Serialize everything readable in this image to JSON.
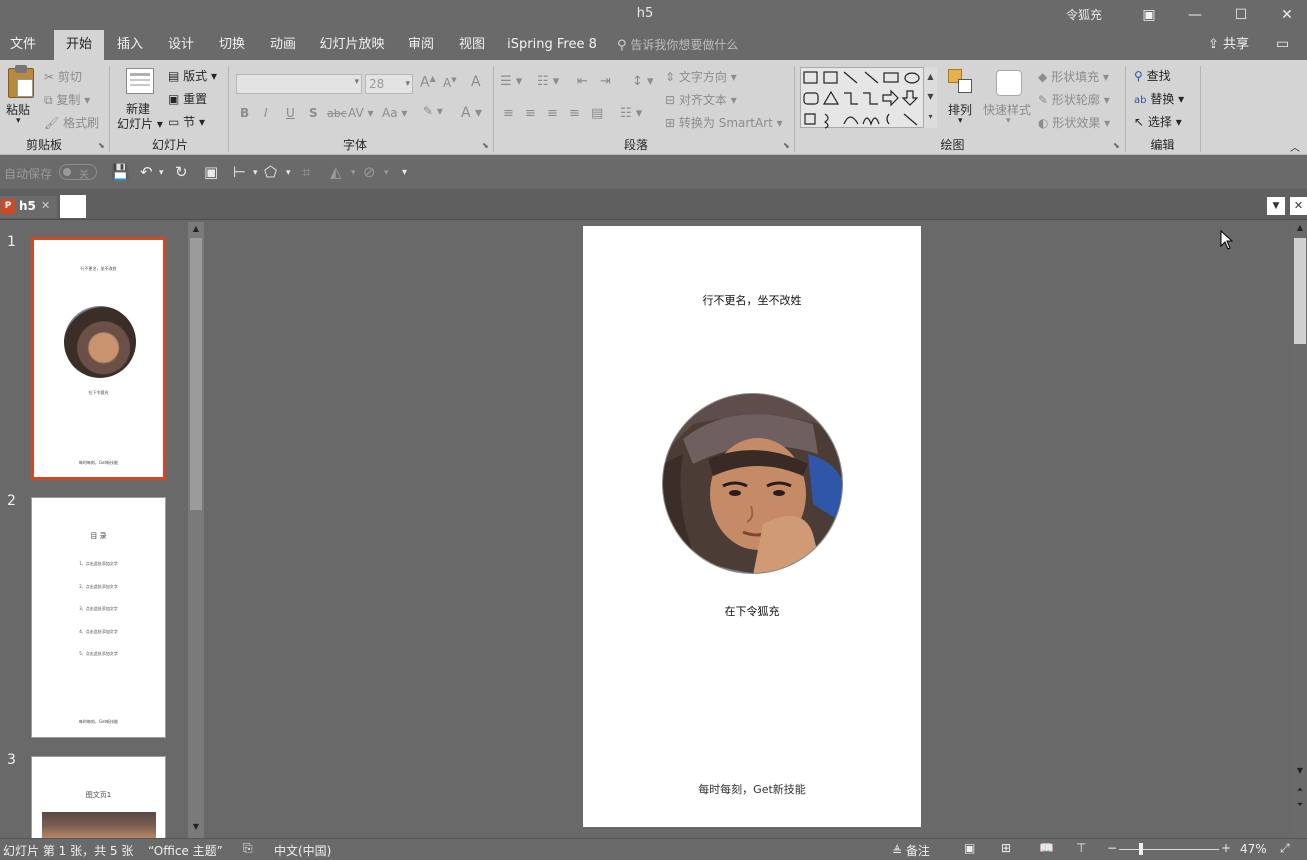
{
  "window": {
    "title": "h5",
    "user": "令狐充",
    "controls": {
      "ribbon_display": "▣",
      "minimize": "—",
      "maximize": "☐",
      "close": "✕"
    }
  },
  "menu": {
    "tabs": [
      "文件",
      "开始",
      "插入",
      "设计",
      "切换",
      "动画",
      "幻灯片放映",
      "审阅",
      "视图",
      "iSpring Free 8"
    ],
    "active_tab": "开始",
    "tell_me": "告诉我你想要做什么",
    "share": "共享"
  },
  "ribbon": {
    "clipboard": {
      "paste": "粘贴",
      "cut": "剪切",
      "copy": "复制",
      "format_painter": "格式刷",
      "label": "剪贴板"
    },
    "slides": {
      "new_slide_line1": "新建",
      "new_slide_line2": "幻灯片",
      "layout": "版式",
      "reset": "重置",
      "section": "节",
      "label": "幻灯片"
    },
    "font": {
      "font_name": "",
      "font_size": "28",
      "bold": "B",
      "italic": "I",
      "underline": "U",
      "shadow": "S",
      "strike": "abc",
      "spacing": "AV",
      "case": "Aa",
      "grow": "A",
      "shrink": "A",
      "clear": "A",
      "color": "A",
      "label": "字体"
    },
    "paragraph": {
      "text_direction": "文字方向",
      "align_text": "对齐文本",
      "smartart": "转换为 SmartArt",
      "label": "段落"
    },
    "drawing": {
      "arrange": "排列",
      "quick_styles": "快速样式",
      "shape_fill": "形状填充",
      "shape_outline": "形状轮廓",
      "shape_effects": "形状效果",
      "label": "绘图"
    },
    "editing": {
      "find": "查找",
      "replace": "替换",
      "select": "选择",
      "label": "编辑"
    }
  },
  "qat": {
    "autosave": "自动保存",
    "autosave_state": "关"
  },
  "doc_tab": {
    "name": "h5"
  },
  "slides": [
    {
      "number": "1",
      "selected": true,
      "lines": [
        "行不更名，坐不改姓",
        "在下令狐充",
        "每时每刻，Get新技能"
      ]
    },
    {
      "number": "2",
      "selected": false,
      "title": "目  录",
      "items": [
        "1、点击此处添加文字",
        "2、点击此处添加文字",
        "3、点击此处添加文字",
        "4、点击此处添加文字",
        "5、点击此处添加文字"
      ],
      "footer": "每时每刻，Get新技能"
    },
    {
      "number": "3",
      "selected": false,
      "title": "图文页1"
    }
  ],
  "main_slide": {
    "heading": "行不更名，坐不改姓",
    "name": "在下令狐充",
    "footer": "每时每刻，Get新技能"
  },
  "status": {
    "slide_info": "幻灯片 第 1 张，共 5 张",
    "theme": "“Office 主题”",
    "language": "中文(中国)",
    "notes": "备注",
    "zoom": "47%"
  }
}
